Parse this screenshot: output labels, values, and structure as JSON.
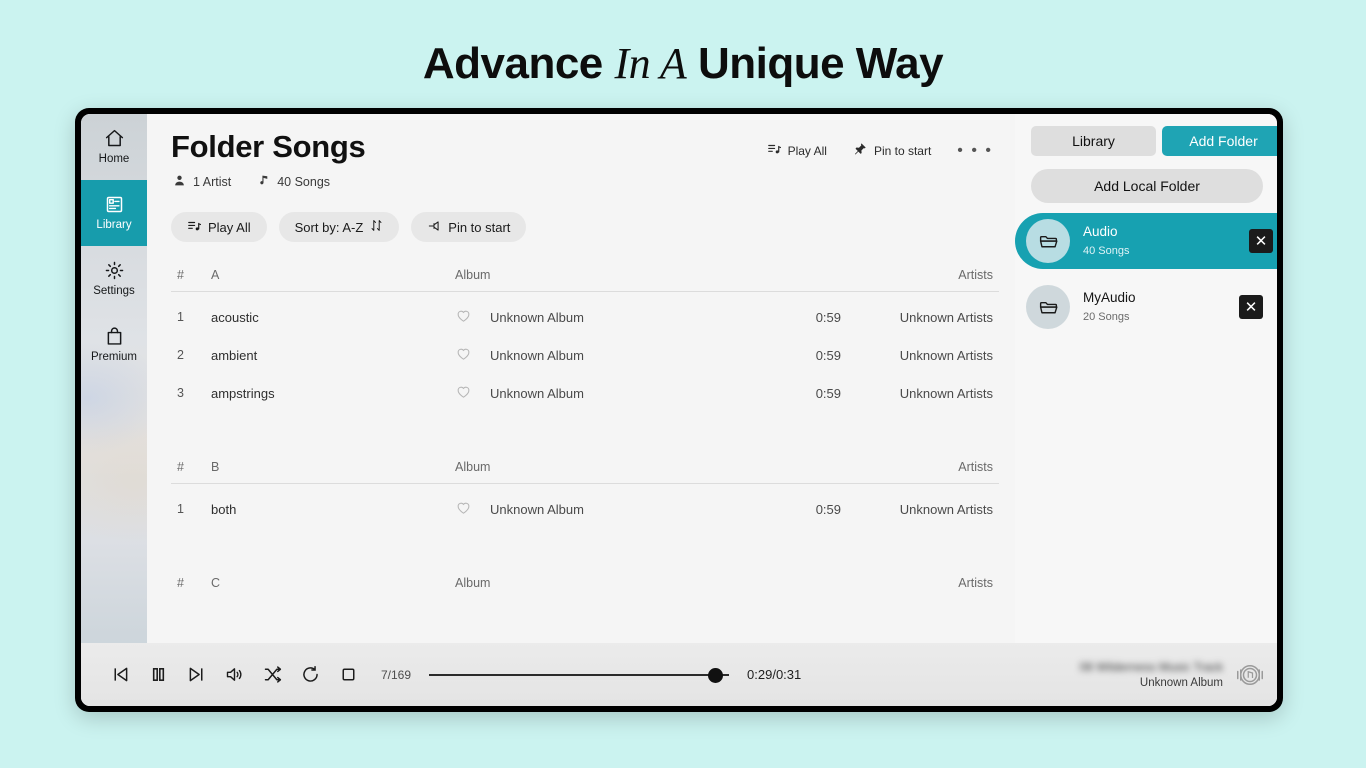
{
  "headline": {
    "part1": "Advance ",
    "italic": "In A",
    "part2": " Unique Way"
  },
  "sidebar": {
    "items": [
      {
        "label": "Home",
        "icon": "home-icon",
        "active": false
      },
      {
        "label": "Library",
        "icon": "library-icon",
        "active": true
      },
      {
        "label": "Settings",
        "icon": "gear-icon",
        "active": false
      },
      {
        "label": "Premium",
        "icon": "bag-icon",
        "active": false
      }
    ]
  },
  "header": {
    "title": "Folder Songs",
    "actions": [
      {
        "label": "Play All",
        "icon": "playlist-icon"
      },
      {
        "label": "Pin to start",
        "icon": "pin-icon"
      }
    ],
    "more_label": "• • •",
    "meta": [
      {
        "label": "1 Artist",
        "icon": "person-icon"
      },
      {
        "label": "40 Songs",
        "icon": "music-note-icon"
      }
    ],
    "pills": [
      {
        "label": "Play All",
        "icon": "playlist-icon"
      },
      {
        "label": "Sort by:  A-Z",
        "icon": "sort-arrows-icon"
      },
      {
        "label": "Pin to start",
        "icon": "pin-icon"
      }
    ]
  },
  "table": {
    "columns": {
      "num": "#",
      "album": "Album",
      "artists": "Artists"
    },
    "groups": [
      {
        "letter": "A",
        "rows": [
          {
            "num": "1",
            "title": "acoustic",
            "album": "Unknown Album",
            "duration": "0:59",
            "artists": "Unknown Artists"
          },
          {
            "num": "2",
            "title": "ambient",
            "album": "Unknown Album",
            "duration": "0:59",
            "artists": "Unknown Artists"
          },
          {
            "num": "3",
            "title": "ampstrings",
            "album": "Unknown Album",
            "duration": "0:59",
            "artists": "Unknown Artists"
          }
        ]
      },
      {
        "letter": "B",
        "rows": [
          {
            "num": "1",
            "title": "both",
            "album": "Unknown Album",
            "duration": "0:59",
            "artists": "Unknown Artists"
          }
        ]
      },
      {
        "letter": "C",
        "rows": []
      }
    ]
  },
  "right_panel": {
    "tabs": [
      {
        "label": "Library",
        "active": false
      },
      {
        "label": "Add Folder",
        "active": true
      }
    ],
    "add_local_label": "Add Local Folder",
    "folders": [
      {
        "name": "Audio",
        "count": "40 Songs",
        "selected": true,
        "close_label": "✕"
      },
      {
        "name": "MyAudio",
        "count": "20 Songs",
        "selected": false,
        "close_label": "✕"
      }
    ]
  },
  "player": {
    "controls": [
      "previous-icon",
      "pause-icon",
      "next-icon",
      "volume-icon",
      "shuffle-icon",
      "repeat-icon",
      "stop-icon"
    ],
    "track_counter": "7/169",
    "time": "0:29/0:31",
    "now_playing_title": "08 Wilderness Music Track",
    "now_playing_album": "Unknown Album"
  },
  "colors": {
    "accent": "#1fa4b4",
    "accent_dark": "#179cac",
    "background": "#cbf3f0",
    "frame": "#000000"
  }
}
